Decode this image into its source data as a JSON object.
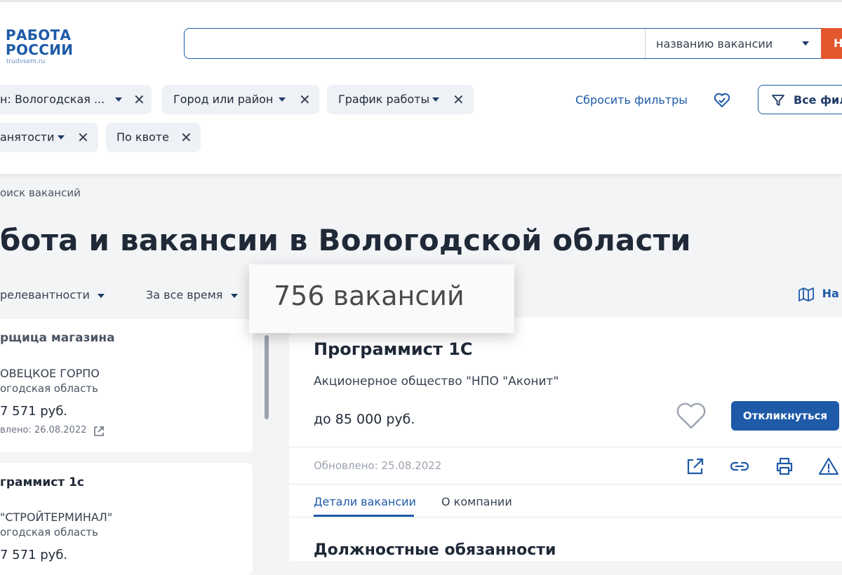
{
  "header": {
    "logo_line1": "РАБОТА",
    "logo_line2": "РОССИИ",
    "logo_site": "trudvsem.ru",
    "search": {
      "value": "",
      "select_label": "названию вакансии",
      "button_label": "Н"
    }
  },
  "filters": {
    "chips": [
      {
        "label": "н: Вологодская ..."
      },
      {
        "label": "Город или район"
      },
      {
        "label": "График работы"
      },
      {
        "label": "анятости"
      },
      {
        "label": "По квоте"
      }
    ],
    "reset_label": "Сбросить фильтры",
    "all_filters_label": "Все фил"
  },
  "breadcrumb": "оиск вакансий",
  "page_title": "бота и вакансии в Вологодской области",
  "sort": {
    "by": "релевантности",
    "period": "За все время"
  },
  "map_label": "На",
  "vacancy_count": "756 вакансий",
  "list": [
    {
      "title": "рщица магазина",
      "company": "ОВЕЦКОЕ ГОРПО",
      "region": "огодская область",
      "salary": "7 571 руб.",
      "updated": "влено: 26.08.2022"
    },
    {
      "title": "граммист 1с",
      "company": "\"СТРОЙТЕРМИНАЛ\"",
      "region": "огодская область",
      "salary": "7 571 руб."
    }
  ],
  "detail": {
    "title": "Программист 1С",
    "company": "Акционерное общество \"НПО \"Аконит\"",
    "salary": "до 85 000 руб.",
    "apply_label": "Откликнуться",
    "updated": "Обновлено: 25.08.2022",
    "tabs": [
      "Детали вакансии",
      "О компании"
    ],
    "section_title": "Должностные обязанности"
  },
  "colors": {
    "primary": "#1e5aa8",
    "accent": "#e4572e",
    "chip_bg": "#eef1f6"
  }
}
